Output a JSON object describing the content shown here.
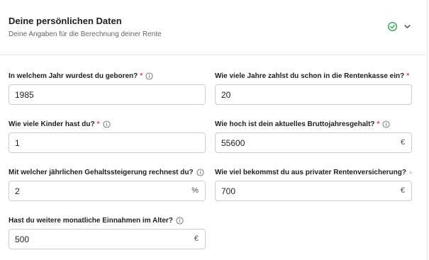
{
  "header": {
    "title": "Deine persönlichen Daten",
    "subtitle": "Deine Angaben für die Berechnung deiner Rente",
    "status_icon": "check-circle-icon",
    "toggle_icon": "chevron-down-icon"
  },
  "colors": {
    "required": "#e53935",
    "success": "#2fae5b",
    "border": "#c9cdd2"
  },
  "fields": [
    {
      "label": "In welchem Jahr wurdest du geboren?",
      "required": "*",
      "value": "1985",
      "suffix": ""
    },
    {
      "label": "Wie viele Jahre zahlst du schon in die Rentenkasse ein?",
      "required": "*",
      "value": "20",
      "suffix": ""
    },
    {
      "label": "Wie viele Kinder hast du?",
      "required": "*",
      "value": "1",
      "suffix": ""
    },
    {
      "label": "Wie hoch ist dein aktuelles Bruttojahresgehalt?",
      "required": "*",
      "value": "55600",
      "suffix": "€"
    },
    {
      "label": "Mit welcher jährlichen Gehaltssteigerung rechnest du?",
      "required": "",
      "value": "2",
      "suffix": "%"
    },
    {
      "label": "Wie viel bekommst du aus privater Rentenversicherung?",
      "required": "",
      "value": "700",
      "suffix": "€"
    },
    {
      "label": "Hast du weitere monatliche Einnahmen im Alter?",
      "required": "",
      "value": "500",
      "suffix": "€"
    }
  ]
}
